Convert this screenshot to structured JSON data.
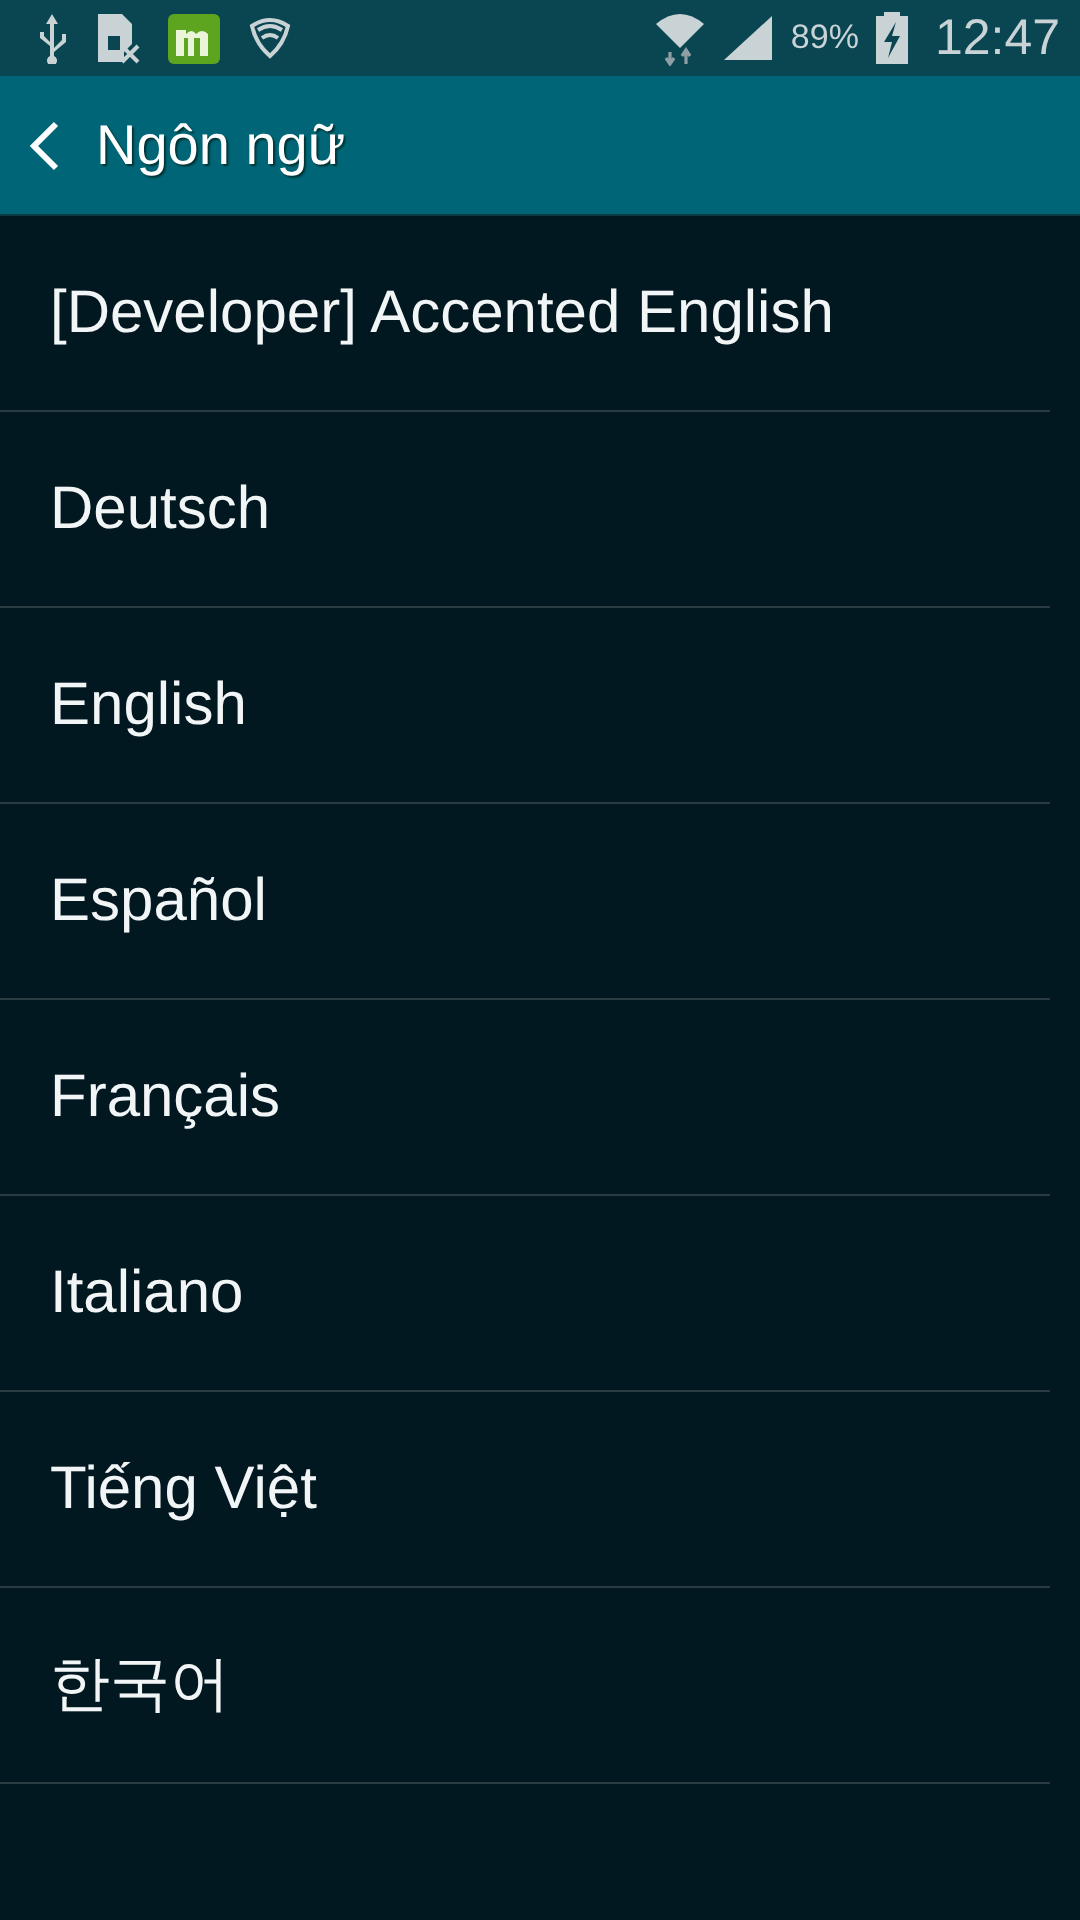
{
  "status_bar": {
    "battery": "89%",
    "time": "12:47"
  },
  "app_bar": {
    "title": "Ngôn ngữ"
  },
  "languages": [
    {
      "label": "[Developer] Accented English"
    },
    {
      "label": "Deutsch"
    },
    {
      "label": "English"
    },
    {
      "label": "Español"
    },
    {
      "label": "Français"
    },
    {
      "label": "Italiano"
    },
    {
      "label": "Tiếng Việt"
    },
    {
      "label": "한국어"
    }
  ]
}
